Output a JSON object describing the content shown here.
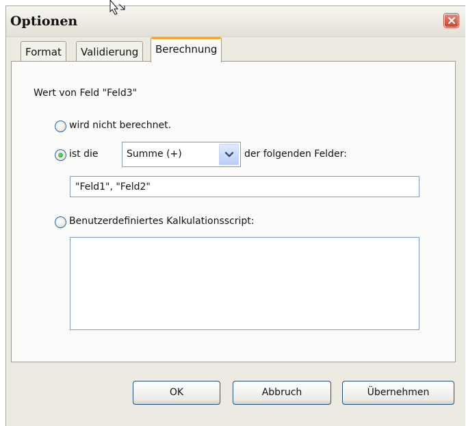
{
  "dialog": {
    "title": "Optionen",
    "close_icon": "close-icon"
  },
  "tabs": [
    {
      "label": "Format",
      "active": false
    },
    {
      "label": "Validierung",
      "active": false
    },
    {
      "label": "Berechnung",
      "active": true
    }
  ],
  "calculation": {
    "field_caption": "Wert von Feld \"Feld3\"",
    "option_none": {
      "label": "wird nicht berechnet.",
      "selected": false
    },
    "option_sum": {
      "label_prefix": "ist die",
      "label_suffix": "der folgenden Felder:",
      "selected": true,
      "operation_value": "Summe (+)",
      "fields_value": "\"Feld1\", \"Feld2\""
    },
    "option_script": {
      "label": "Benutzerdefiniertes Kalkulationsscript:",
      "selected": false,
      "script_value": ""
    }
  },
  "buttons": {
    "ok": "OK",
    "cancel": "Abbruch",
    "apply": "Übernehmen"
  },
  "colors": {
    "dialog_bg": "#eceae1",
    "active_tab_accent": "#f3a23a",
    "radio_selected": "#1d8f1d",
    "close_button": "#c6472d"
  }
}
